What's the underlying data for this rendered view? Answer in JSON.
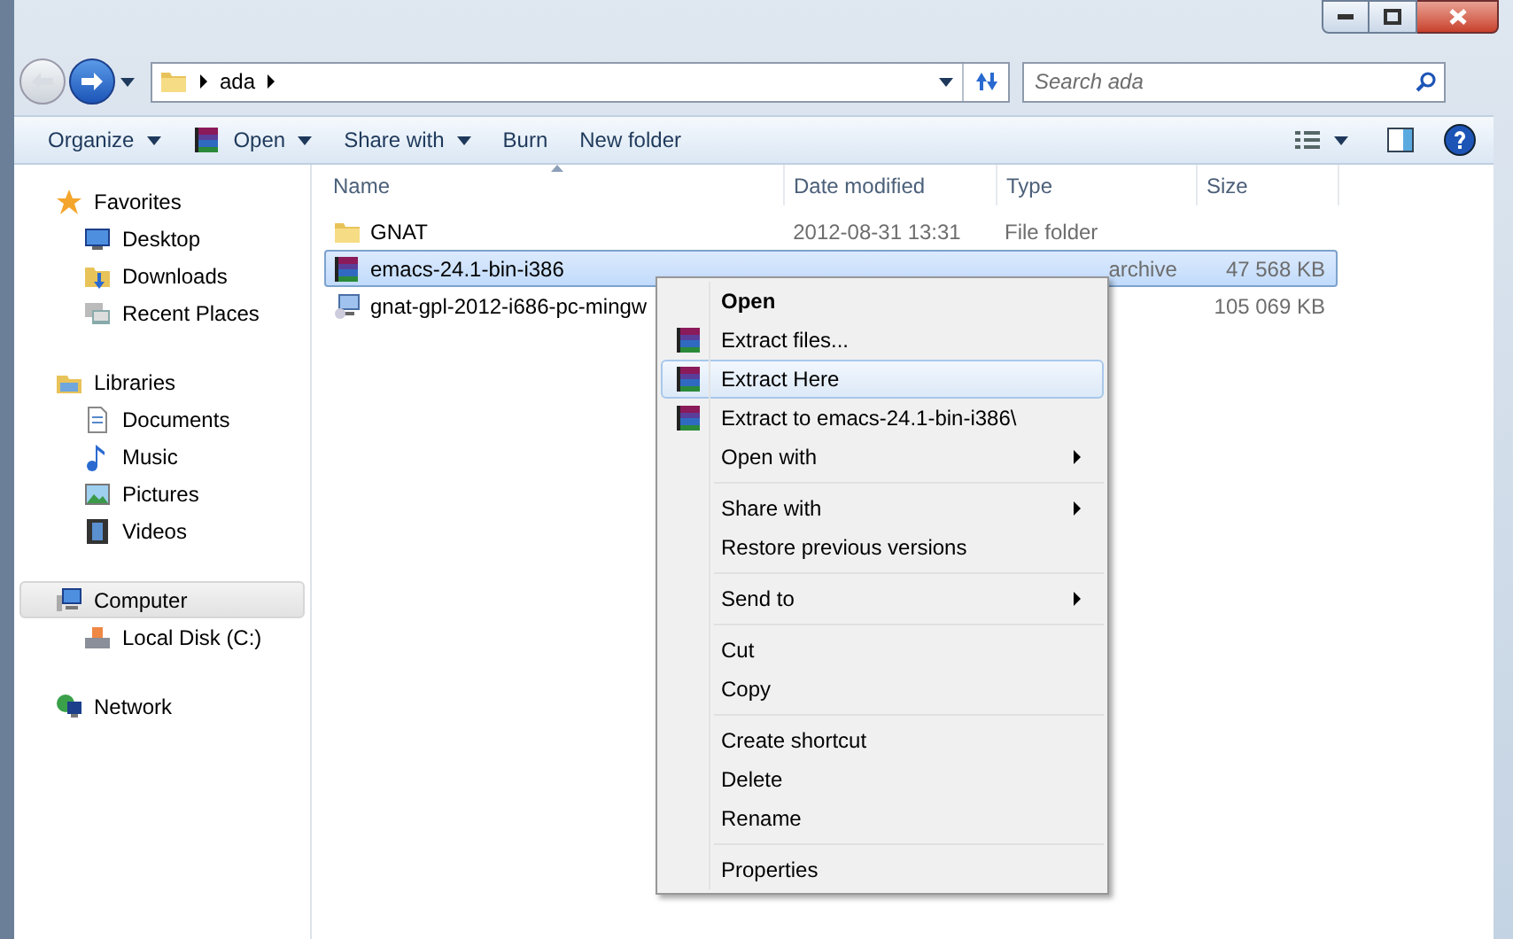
{
  "address_bar": {
    "crumbs": [
      "ada"
    ]
  },
  "search": {
    "placeholder": "Search ada"
  },
  "toolbar": {
    "buttons": [
      {
        "label": "Organize",
        "dropdown": true
      },
      {
        "label": "Open",
        "dropdown": true
      },
      {
        "label": "Share with",
        "dropdown": true
      },
      {
        "label": "Burn",
        "dropdown": false
      },
      {
        "label": "New folder",
        "dropdown": false
      }
    ]
  },
  "sidebar": {
    "groups": [
      {
        "label": "Favorites",
        "selected": false,
        "children": [
          {
            "label": "Desktop"
          },
          {
            "label": "Downloads"
          },
          {
            "label": "Recent Places"
          }
        ]
      },
      {
        "label": "Libraries",
        "selected": false,
        "children": [
          {
            "label": "Documents"
          },
          {
            "label": "Music"
          },
          {
            "label": "Pictures"
          },
          {
            "label": "Videos"
          }
        ]
      },
      {
        "label": "Computer",
        "selected": true,
        "children": [
          {
            "label": "Local Disk (C:)"
          }
        ]
      },
      {
        "label": "Network",
        "selected": false
      }
    ]
  },
  "table": {
    "columns": [
      "Name",
      "Date modified",
      "Type",
      "Size"
    ],
    "rows": [
      {
        "name": "GNAT",
        "date": "2012-08-31 13:31",
        "type": "File folder",
        "size": "",
        "selected": false
      },
      {
        "name": "emacs-24.1-bin-i386",
        "date": "",
        "type": "archive",
        "size": "47 568 KB",
        "selected": true
      },
      {
        "name": "gnat-gpl-2012-i686-pc-mingw",
        "date": "",
        "type": "",
        "size": "105 069 KB",
        "selected": false
      }
    ]
  },
  "context_menu": {
    "groups": [
      [
        {
          "label": "Open",
          "default": true,
          "rar": false,
          "submenu": false,
          "selected": false
        },
        {
          "label": "Extract files...",
          "default": false,
          "rar": true,
          "submenu": false,
          "selected": false
        },
        {
          "label": "Extract Here",
          "default": false,
          "rar": true,
          "submenu": false,
          "selected": true
        },
        {
          "label": "Extract to emacs-24.1-bin-i386\\",
          "default": false,
          "rar": true,
          "submenu": false,
          "selected": false
        },
        {
          "label": "Open with",
          "default": false,
          "rar": false,
          "submenu": true,
          "selected": false
        }
      ],
      [
        {
          "label": "Share with",
          "default": false,
          "rar": false,
          "submenu": true,
          "selected": false
        },
        {
          "label": "Restore previous versions",
          "default": false,
          "rar": false,
          "submenu": false,
          "selected": false
        }
      ],
      [
        {
          "label": "Send to",
          "default": false,
          "rar": false,
          "submenu": true,
          "selected": false
        }
      ],
      [
        {
          "label": "Cut",
          "default": false,
          "rar": false,
          "submenu": false,
          "selected": false
        },
        {
          "label": "Copy",
          "default": false,
          "rar": false,
          "submenu": false,
          "selected": false
        }
      ],
      [
        {
          "label": "Create shortcut",
          "default": false,
          "rar": false,
          "submenu": false,
          "selected": false
        },
        {
          "label": "Delete",
          "default": false,
          "rar": false,
          "submenu": false,
          "selected": false
        },
        {
          "label": "Rename",
          "default": false,
          "rar": false,
          "submenu": false,
          "selected": false
        }
      ],
      [
        {
          "label": "Properties",
          "default": false,
          "rar": false,
          "submenu": false,
          "selected": false
        }
      ]
    ]
  }
}
